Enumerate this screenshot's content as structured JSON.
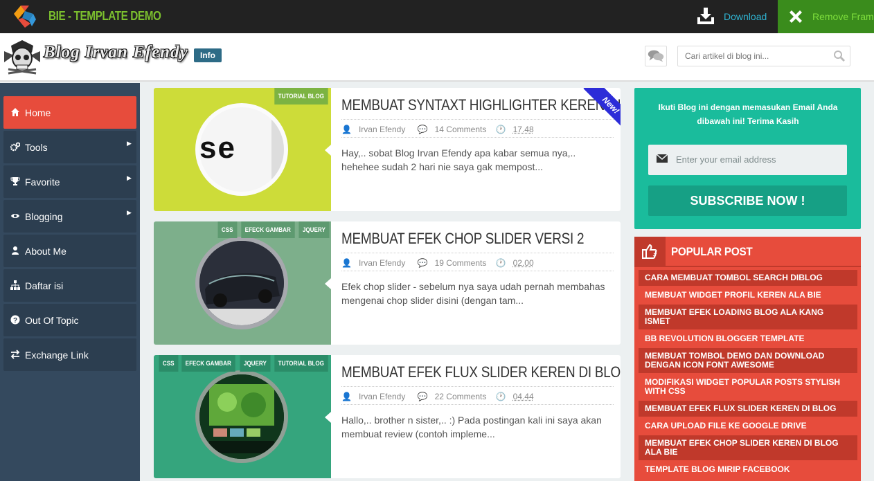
{
  "topbar": {
    "title": "BIE - TEMPLATE DEMO",
    "download_label": "Download",
    "remove_frame_label": "Remove Frame"
  },
  "header": {
    "blog_name": "Blog Irvan Efendy",
    "info_label": "Info",
    "search_placeholder": "Cari artikel di blog ini..."
  },
  "sidebar": {
    "items": [
      {
        "label": "Home",
        "icon": "home-icon",
        "active": true,
        "submenu": false
      },
      {
        "label": "Tools",
        "icon": "cogs-icon",
        "active": false,
        "submenu": true
      },
      {
        "label": "Favorite",
        "icon": "trophy-icon",
        "active": false,
        "submenu": true
      },
      {
        "label": "Blogging",
        "icon": "eye-icon",
        "active": false,
        "submenu": true
      },
      {
        "label": "About Me",
        "icon": "user-icon",
        "active": false,
        "submenu": false
      },
      {
        "label": "Daftar isi",
        "icon": "sitemap-icon",
        "active": false,
        "submenu": false
      },
      {
        "label": "Out Of Topic",
        "icon": "question-icon",
        "active": false,
        "submenu": false
      },
      {
        "label": "Exchange Link",
        "icon": "exchange-icon",
        "active": false,
        "submenu": false
      }
    ]
  },
  "posts": [
    {
      "title": "MEMBUAT SYNTAXT HIGHLIGHTER KEREN DI BLOG",
      "tags": [
        "TUTORIAL BLOG"
      ],
      "author": "Irvan Efendy",
      "comments": "14 Comments",
      "time": "17.48",
      "excerpt": "Hay,.. sobat Blog Irvan Efendy apa kabar semua nya,.. hehehee sudah 2 hari nie saya gak mempost...",
      "ribbon": "New!",
      "thumb_color": "#cddc39",
      "thumb_text": "se"
    },
    {
      "title": "MEMBUAT EFEK CHOP SLIDER VERSI 2",
      "tags": [
        "CSS",
        "EFECK GAMBAR",
        "JQUERY"
      ],
      "author": "Irvan Efendy",
      "comments": "19 Comments",
      "time": "02.00",
      "excerpt": "Efek chop slider - sebelum nya saya udah pernah membahas mengenai chop slider disini  (dengan tam...",
      "thumb_color": "#7daf8b"
    },
    {
      "title": "MEMBUAT EFEK FLUX SLIDER KEREN DI BLOG",
      "tags": [
        "CSS",
        "EFECK GAMBAR",
        "JQUERY",
        "TUTORIAL BLOG"
      ],
      "author": "Irvan Efendy",
      "comments": "22 Comments",
      "time": "04.44",
      "excerpt": "Hallo,.. brother n sister,.. :) Pada postingan kali ini saya akan membuat review (contoh impleme...",
      "thumb_color": "#35a57d"
    }
  ],
  "subscribe": {
    "text": "Ikuti Blog ini dengan memasukan Email Anda dibawah ini! Terima Kasih",
    "placeholder": "Enter your email address",
    "button_label": "SUBSCRIBE NOW !"
  },
  "popular": {
    "title": "POPULAR POST",
    "items": [
      "CARA MEMBUAT TOMBOL SEARCH DIBLOG",
      "MEMBUAT WIDGET PROFIL KEREN ALA BIE",
      "MEMBUAT EFEK LOADING BLOG ALA KANG ISMET",
      "BB REVOLUTION BLOGGER TEMPLATE",
      "MEMBUAT TOMBOL DEMO DAN DOWNLOAD DENGAN ICON FONT AWESOME",
      "MODIFIKASI WIDGET POPULAR POSTS STYLISH WITH CSS",
      "MEMBUAT EFEK FLUX SLIDER KEREN DI BLOG",
      "CARA UPLOAD FILE KE GOOGLE DRIVE",
      "MEMBUAT EFEK CHOP SLIDER KEREN DI BLOG ALA BIE",
      "TEMPLATE BLOG MIRIP FACEBOOK"
    ]
  },
  "colors": {
    "accent_red": "#e74c3c",
    "accent_teal": "#1abc9c",
    "sidebar_bg": "#34495e",
    "brand_green": "#7bbf2e"
  }
}
